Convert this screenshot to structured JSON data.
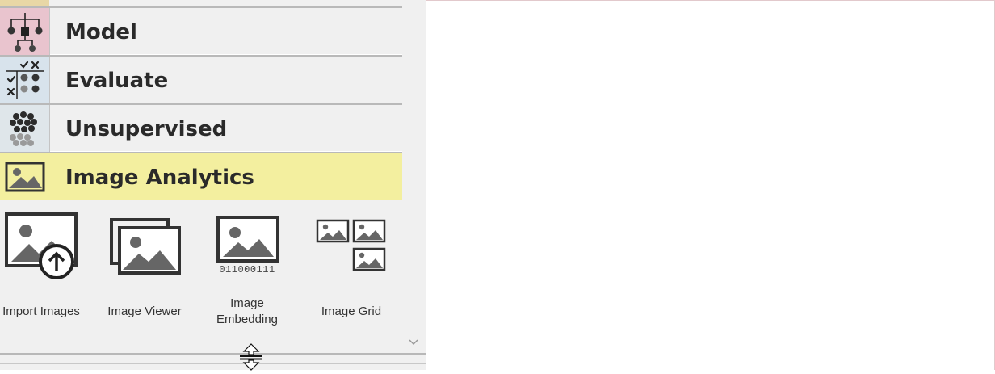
{
  "toolbox": {
    "categories": [
      {
        "label": "Model",
        "icon": "model-tree-icon",
        "color": "#e9c4ce"
      },
      {
        "label": "Evaluate",
        "icon": "evaluate-checks-icon",
        "color": "#d8e3ec"
      },
      {
        "label": "Unsupervised",
        "icon": "clusters-icon",
        "color": "#dfe6ea"
      },
      {
        "label": "Image Analytics",
        "icon": "image-icon",
        "color": "#f3ef9f"
      }
    ],
    "active_category": "Image Analytics",
    "widgets": [
      {
        "label": "Import Images",
        "icon": "import-images-icon"
      },
      {
        "label": "Image Viewer",
        "icon": "image-viewer-icon"
      },
      {
        "label_line1": "Image",
        "label_line2": "Embedding",
        "icon": "image-embedding-icon",
        "binary_text": "011000111"
      },
      {
        "label": "Image Grid",
        "icon": "image-grid-icon"
      }
    ]
  }
}
